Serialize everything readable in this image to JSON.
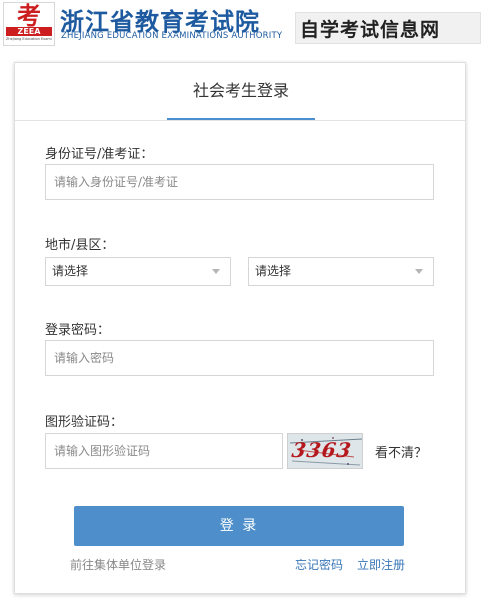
{
  "header": {
    "logo_mark": "考",
    "logo_word": "ZEEA",
    "logo_sub": "Zhejiang Education Examinations Authority",
    "title": "浙江省教育考试院",
    "subtitle": "ZHEJIANG EDUCATION EXAMINATIONS AUTHORITY",
    "banner": "自学考试信息网"
  },
  "login": {
    "tab_label": "社会考生登录",
    "id_label": "身份证号/准考证：",
    "id_placeholder": "请输入身份证号/准考证",
    "region_label": "地市/县区：",
    "city_select": "请选择",
    "county_select": "请选择",
    "password_label": "登录密码：",
    "password_placeholder": "请输入密码",
    "captcha_label": "图形验证码：",
    "captcha_placeholder": "请输入图形验证码",
    "captcha_text": "3363",
    "refresh_label": "看不清？",
    "login_button": "登 录",
    "group_login_link": "前往集体单位登录",
    "forgot_password_link": "忘记密码",
    "register_link": "立即注册"
  },
  "colors": {
    "brand_blue": "#1e5aa0",
    "button_blue": "#4e8fcb",
    "tab_underline": "#4a90d0",
    "logo_red": "#cc1e1e",
    "captcha_red": "#b5181c",
    "link_gray": "#888888",
    "link_blue": "#3a76b8"
  },
  "icons": {
    "select_arrow": "chevron-down-icon"
  }
}
